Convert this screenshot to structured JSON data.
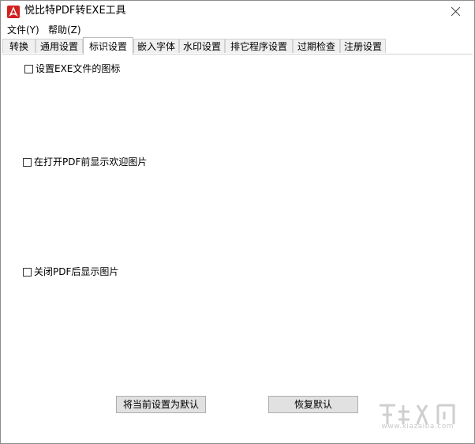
{
  "window": {
    "title": "悦比特PDF转EXE工具"
  },
  "menu": [
    {
      "label": "文件(Y)"
    },
    {
      "label": "帮助(Z)"
    }
  ],
  "tabs": [
    {
      "label": "转换",
      "active": false
    },
    {
      "label": "通用设置",
      "active": false
    },
    {
      "label": "标识设置",
      "active": true
    },
    {
      "label": "嵌入字体",
      "active": false
    },
    {
      "label": "水印设置",
      "active": false
    },
    {
      "label": "排它程序设置",
      "active": false
    },
    {
      "label": "过期检查",
      "active": false
    },
    {
      "label": "注册设置",
      "active": false
    }
  ],
  "options": [
    {
      "label": "设置EXE文件的图标",
      "checked": false
    },
    {
      "label": "在打开PDF前显示欢迎图片",
      "checked": false
    },
    {
      "label": "关闭PDF后显示图片",
      "checked": false
    }
  ],
  "buttons": {
    "set_default": "将当前设置为默认",
    "restore_default": "恢复默认"
  },
  "watermark": {
    "text": "www.xiazaiba.com"
  },
  "colors": {
    "app_icon": "#d21f1f",
    "button_bg": "#e1e1e1",
    "tab_bg": "#f0f0f0"
  }
}
